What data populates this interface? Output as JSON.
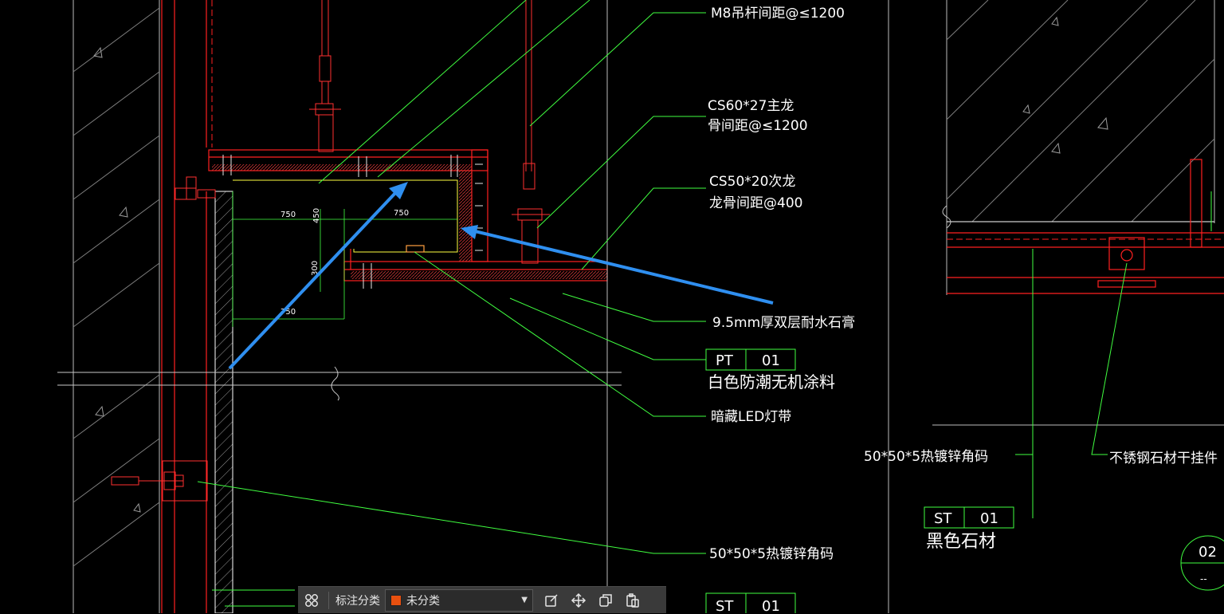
{
  "drawing": {
    "annotations": {
      "hanger": "M8吊杆间距@≤1200",
      "main_keel_1": "CS60*27主龙",
      "main_keel_2": "骨间距@≤1200",
      "sub_keel_1": "CS50*20次龙",
      "sub_keel_2": "龙骨间距@400",
      "gypsum": "9.5mm厚双层耐水石膏",
      "paint_code": "PT",
      "paint_num": "01",
      "paint_desc": "白色防潮无机涂料",
      "led": "暗藏LED灯带",
      "angle_left": "50*50*5热镀锌角码",
      "angle_right": "50*50*5热镀锌角码",
      "stone_hanger": "不锈钢石材干挂件",
      "stone_code": "ST",
      "stone_num": "01",
      "stone_desc": "黑色石材",
      "bottom_code": "ST",
      "bottom_num": "01",
      "section_num": "02",
      "section_sub": "--"
    },
    "dims": {
      "d1": "750",
      "d2": "750",
      "d3": "450",
      "d4": "300",
      "d5": "750"
    }
  },
  "toolbar": {
    "label": "标注分类",
    "category": "未分类",
    "category_color": "#e8500f",
    "icons": [
      "grid-icon",
      "edit-icon",
      "move-icon",
      "copy-icon",
      "paste-icon"
    ]
  }
}
